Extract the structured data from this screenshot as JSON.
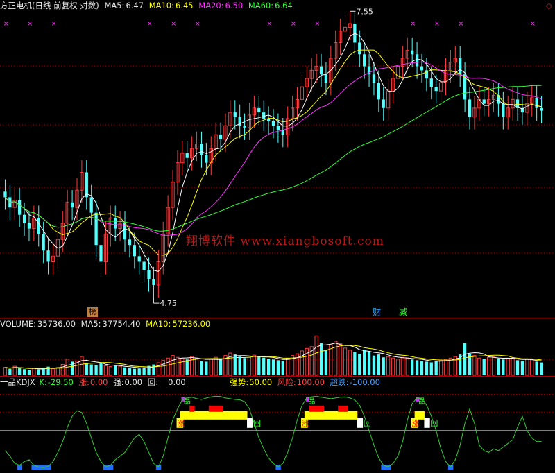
{
  "main": {
    "stock_name": "方正电机",
    "params": "(日线 前复权 对数)",
    "ma5_label": "MA5:",
    "ma5_value": "6.47",
    "ma10_label": "MA10:",
    "ma10_value": "6.45",
    "ma20_label": "MA20:",
    "ma20_value": "6.50",
    "ma60_label": "MA60:",
    "ma60_value": "6.64",
    "high_label": "7.55",
    "low_label": "4.75",
    "markers": [
      "榜",
      "财",
      "减"
    ],
    "corner_icon": "diamond-icon"
  },
  "watermark": "翔博软件 www.xiangbosoft.com",
  "volume": {
    "label": "VOLUME:",
    "value": "35736.00",
    "ma5_label": "MA5:",
    "ma5_value": "37754.40",
    "ma10_label": "MA10:",
    "ma10_value": "57236.00"
  },
  "kdj": {
    "name": "一品KDJX",
    "k_label": "K:",
    "k_value": "-29.50",
    "zhang_label": "涨:",
    "zhang_value": "0.00",
    "qiang_label": "强:",
    "qiang_value": "0.00",
    "hui_label": "回:",
    "hui_value": "0.00",
    "qiangshi_label": "强势:",
    "qiangshi_value": "50.00",
    "fengxian_label": "风险:",
    "fengxian_value": "100.00",
    "chaodie_label": "超跌:",
    "chaodie_value": "-100.00",
    "signal_labels": {
      "zhang": "涨",
      "hui": "回",
      "pin": "品"
    }
  },
  "colors": {
    "up": "#ff3c3c",
    "down": "#54ffff",
    "ma5": "#ffffff",
    "ma10": "#ffff00",
    "ma20": "#ff33ff",
    "ma60": "#33ff33",
    "kline": "#33cc33",
    "strong": "#ffff00",
    "hot": "#ff0000",
    "oversold": "#1e6fff"
  },
  "chart_data": {
    "type": "candlestick",
    "price_range": [
      4.5,
      7.7
    ],
    "annotations": {
      "high": 7.55,
      "low": 4.75
    },
    "closes": [
      5.55,
      5.45,
      5.52,
      5.38,
      5.3,
      5.25,
      5.35,
      5.2,
      5.05,
      4.95,
      5.0,
      5.15,
      5.3,
      5.5,
      5.45,
      5.62,
      5.8,
      5.55,
      5.4,
      5.1,
      4.95,
      5.2,
      5.35,
      5.25,
      5.3,
      5.15,
      5.1,
      5.0,
      4.95,
      4.88,
      4.8,
      4.75,
      4.95,
      5.2,
      5.45,
      5.7,
      5.9,
      6.0,
      5.95,
      6.05,
      6.1,
      5.98,
      5.9,
      6.05,
      6.2,
      6.15,
      6.3,
      6.45,
      6.4,
      6.3,
      6.28,
      6.42,
      6.5,
      6.45,
      6.38,
      6.35,
      6.3,
      6.25,
      6.2,
      6.38,
      6.5,
      6.6,
      6.75,
      6.85,
      6.95,
      7.0,
      6.9,
      6.8,
      7.1,
      7.3,
      7.45,
      7.5,
      7.55,
      7.3,
      7.15,
      7.0,
      6.9,
      6.8,
      6.6,
      6.5,
      6.7,
      6.85,
      7.0,
      7.1,
      7.2,
      7.15,
      7.0,
      6.95,
      6.85,
      6.75,
      6.7,
      6.8,
      6.95,
      7.05,
      7.1,
      6.9,
      6.6,
      6.4,
      6.5,
      6.6,
      6.55,
      6.6,
      6.65,
      6.55,
      6.4,
      6.5,
      6.6,
      6.5,
      6.45,
      6.55,
      6.62,
      6.5,
      6.47
    ],
    "volume_range": [
      0,
      130000
    ],
    "volumes": [
      22000,
      18000,
      25000,
      20000,
      17000,
      15000,
      19000,
      16000,
      21000,
      24000,
      18000,
      22000,
      30000,
      45000,
      38000,
      40000,
      52000,
      35000,
      30000,
      28000,
      33000,
      26000,
      24000,
      27000,
      25000,
      22000,
      20000,
      18000,
      19000,
      22000,
      26000,
      30000,
      35000,
      42000,
      48000,
      55000,
      50000,
      46000,
      44000,
      52000,
      48000,
      40000,
      38000,
      45000,
      50000,
      47000,
      55000,
      62000,
      58000,
      52000,
      48000,
      50000,
      56000,
      53000,
      49000,
      46000,
      44000,
      42000,
      40000,
      48000,
      55000,
      60000,
      68000,
      75000,
      80000,
      110000,
      90000,
      70000,
      85000,
      95000,
      88000,
      76000,
      70000,
      65000,
      60000,
      72000,
      68000,
      55000,
      58000,
      50000,
      52000,
      48000,
      45000,
      50000,
      47000,
      44000,
      42000,
      40000,
      38000,
      36000,
      40000,
      42000,
      45000,
      48000,
      52000,
      58000,
      90000,
      60000,
      55000,
      48000,
      45000,
      50000,
      52000,
      47000,
      44000,
      46000,
      48000,
      42000,
      40000,
      45000,
      43000,
      38000,
      35736
    ],
    "kdj_range": [
      -105,
      105
    ],
    "kdj_levels": {
      "strong": 50,
      "risk": 100,
      "oversold": -100
    },
    "k_values": [
      -55,
      -70,
      -90,
      -95,
      -85,
      -80,
      -95,
      -100,
      -102,
      -98,
      -85,
      -60,
      -30,
      10,
      40,
      55,
      50,
      20,
      -20,
      -60,
      -85,
      -100,
      -95,
      -80,
      -70,
      -60,
      -40,
      -20,
      -10,
      -30,
      -60,
      -90,
      -100,
      -70,
      -20,
      30,
      60,
      85,
      90,
      92,
      88,
      86,
      90,
      93,
      95,
      94,
      90,
      88,
      86,
      85,
      80,
      60,
      20,
      -20,
      -50,
      -75,
      -90,
      -100,
      -90,
      -60,
      -20,
      30,
      70,
      90,
      93,
      95,
      92,
      90,
      88,
      90,
      92,
      93,
      90,
      85,
      70,
      40,
      0,
      -40,
      -75,
      -95,
      -100,
      -90,
      -70,
      -30,
      30,
      75,
      90,
      88,
      70,
      40,
      0,
      -50,
      -85,
      -100,
      -80,
      -40,
      20,
      60,
      20,
      -40,
      -55,
      -60,
      -50,
      -55,
      -45,
      -35,
      -25,
      10,
      40,
      0,
      -20,
      -30,
      -29.5
    ]
  }
}
